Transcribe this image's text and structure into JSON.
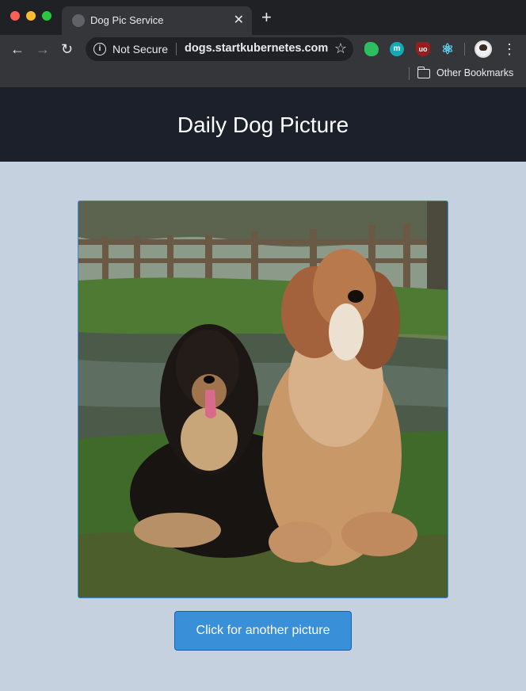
{
  "browser": {
    "tab": {
      "title": "Dog Pic Service",
      "close_icon": "close-icon"
    },
    "new_tab_icon": "plus-icon",
    "nav": {
      "back_icon": "arrow-left-icon",
      "forward_icon": "arrow-right-icon",
      "reload_icon": "reload-icon"
    },
    "omnibox": {
      "security_label": "Not Secure",
      "url": "dogs.startkubernetes.com",
      "info_icon": "info-icon",
      "star_icon": "star-icon"
    },
    "extensions": [
      "evernote-icon",
      "m-extension-icon",
      "ublock-icon",
      "react-devtools-icon"
    ],
    "ext_m_text": "m",
    "ext_ublock_text": "uo",
    "menu_icon": "kebab-menu-icon",
    "bookmarks_bar": {
      "folder_label": "Other Bookmarks",
      "folder_icon": "folder-icon"
    }
  },
  "page": {
    "title": "Daily Dog Picture",
    "image": {
      "subject": "Two Afghan hounds sitting on grass by a pond"
    },
    "button_label": "Click for another picture"
  },
  "colors": {
    "header_bg": "#1b202a",
    "page_bg": "#c5d1de",
    "button_bg": "#3a8fd9",
    "frame_border": "#3d8ad8"
  }
}
